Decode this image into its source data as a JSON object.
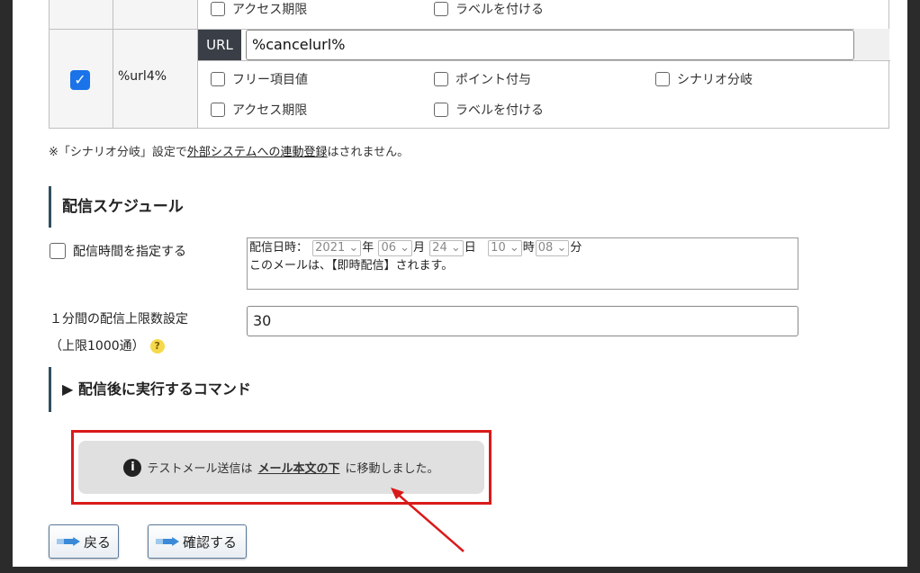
{
  "table": {
    "row1": {
      "opt_access": "アクセス期限",
      "opt_label": "ラベルを付ける"
    },
    "row2": {
      "param": "%url4%",
      "url_tag": "URL",
      "url_value": "%cancelurl%",
      "opt_free": "フリー項目値",
      "opt_point": "ポイント付与",
      "opt_scenario": "シナリオ分岐",
      "opt_access": "アクセス期限",
      "opt_label": "ラベルを付ける"
    }
  },
  "note": {
    "prefix": "※「シナリオ分岐」設定で",
    "link": "外部システムへの連動登録",
    "suffix": "はされません。"
  },
  "schedule": {
    "heading": "配信スケジュール",
    "specify_label": "配信時間を指定する",
    "datetime_label": "配信日時：",
    "year": "2021",
    "year_unit": "年",
    "month": "06",
    "month_unit": "月",
    "day": "24",
    "day_unit": "日",
    "hour": "10",
    "hour_unit": "時",
    "minute": "08",
    "minute_unit": "分",
    "immediate_text": "このメールは、【即時配信】されます。"
  },
  "limit": {
    "label_line1": "１分間の配信上限数設定",
    "label_line2": "（上限1000通）",
    "value": "30",
    "help_glyph": "?"
  },
  "command": {
    "heading": "▶ 配信後に実行するコマンド"
  },
  "info": {
    "icon_glyph": "i",
    "text_before": "テストメール送信は",
    "link": "メール本文の下",
    "text_after": "に移動しました。"
  },
  "buttons": {
    "back": "戻る",
    "confirm": "確認する"
  },
  "colors": {
    "highlight_border": "#d91a1a",
    "checkbox": "#1a73e8",
    "accent_bar": "#2f4f5f"
  }
}
